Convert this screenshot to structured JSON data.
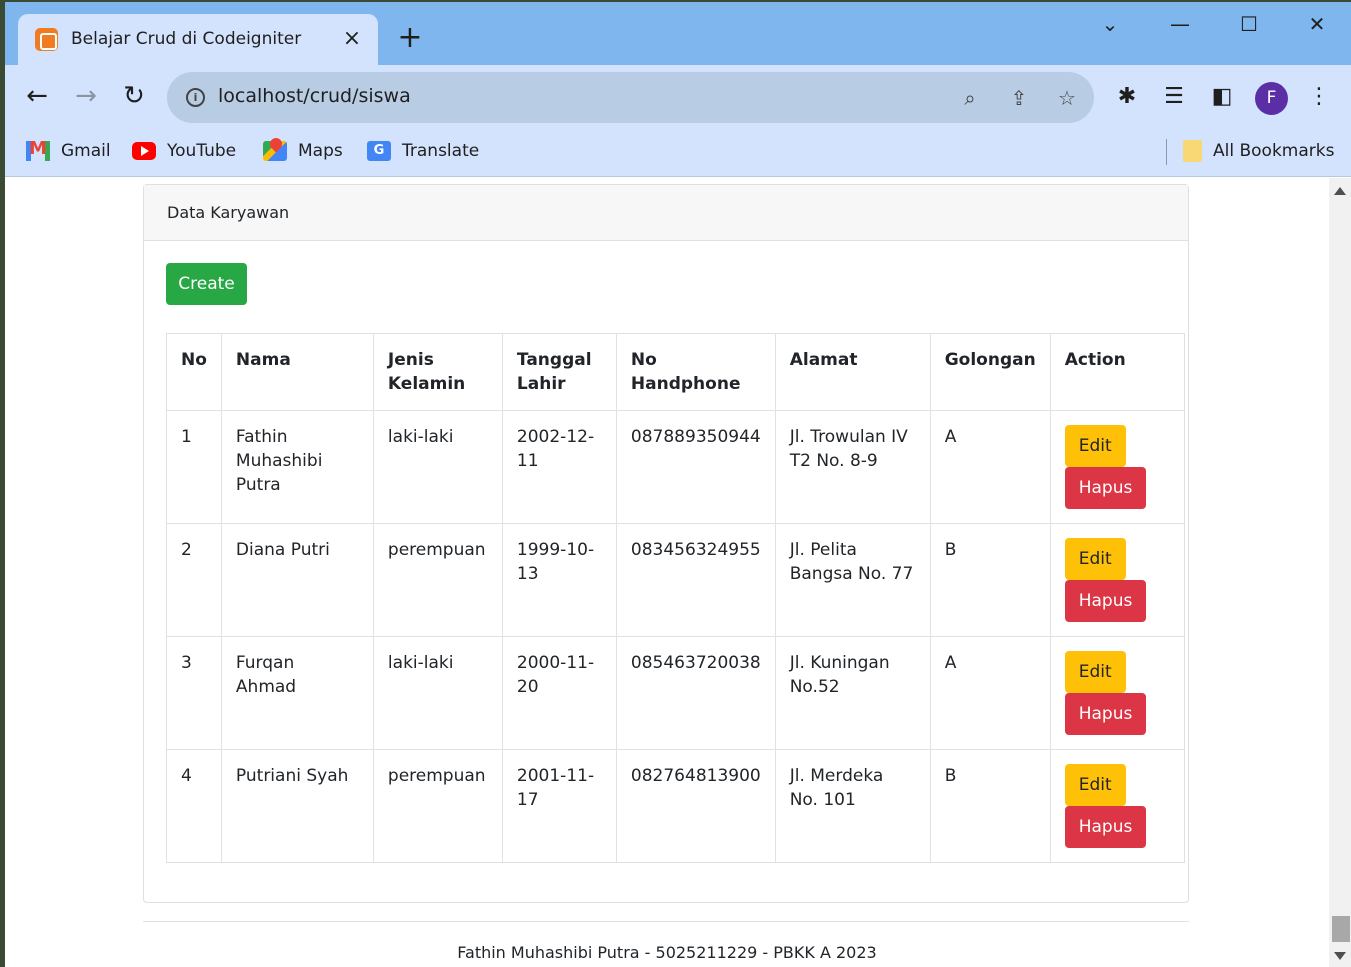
{
  "browser": {
    "tab_title": "Belajar Crud di Codeigniter",
    "url": "localhost/crud/siswa",
    "profile_initial": "F",
    "accent_color": "#7fb6ee"
  },
  "bookmarks": {
    "items": [
      "Gmail",
      "YouTube",
      "Maps",
      "Translate"
    ],
    "all_bookmarks": "All Bookmarks"
  },
  "page": {
    "card_title": "Data Karyawan",
    "create_label": "Create",
    "columns": [
      "No",
      "Nama",
      "Jenis Kelamin",
      "Tanggal Lahir",
      "No Handphone",
      "Alamat",
      "Golongan",
      "Action"
    ],
    "rows": [
      {
        "no": "1",
        "nama": "Fathin Muhashibi Putra",
        "jk": "laki-laki",
        "tgl": "2002-12-11",
        "hp": "087889350944",
        "alamat": "Jl. Trowulan IV T2 No. 8-9",
        "gol": "A"
      },
      {
        "no": "2",
        "nama": "Diana Putri",
        "jk": "perempuan",
        "tgl": "1999-10-13",
        "hp": "083456324955",
        "alamat": "Jl. Pelita Bangsa No. 77",
        "gol": "B"
      },
      {
        "no": "3",
        "nama": "Furqan Ahmad",
        "jk": "laki-laki",
        "tgl": "2000-11-20",
        "hp": "085463720038",
        "alamat": "Jl. Kuningan No.52",
        "gol": "A"
      },
      {
        "no": "4",
        "nama": "Putriani Syah",
        "jk": "perempuan",
        "tgl": "2001-11-17",
        "hp": "082764813900",
        "alamat": "Jl. Merdeka No. 101",
        "gol": "B"
      }
    ],
    "edit_label": "Edit",
    "hapus_label": "Hapus",
    "footer": "Fathin Muhashibi Putra - 5025211229 - PBKK A 2023"
  },
  "colors": {
    "create": "#28a745",
    "edit": "#ffc107",
    "hapus": "#dc3545"
  }
}
